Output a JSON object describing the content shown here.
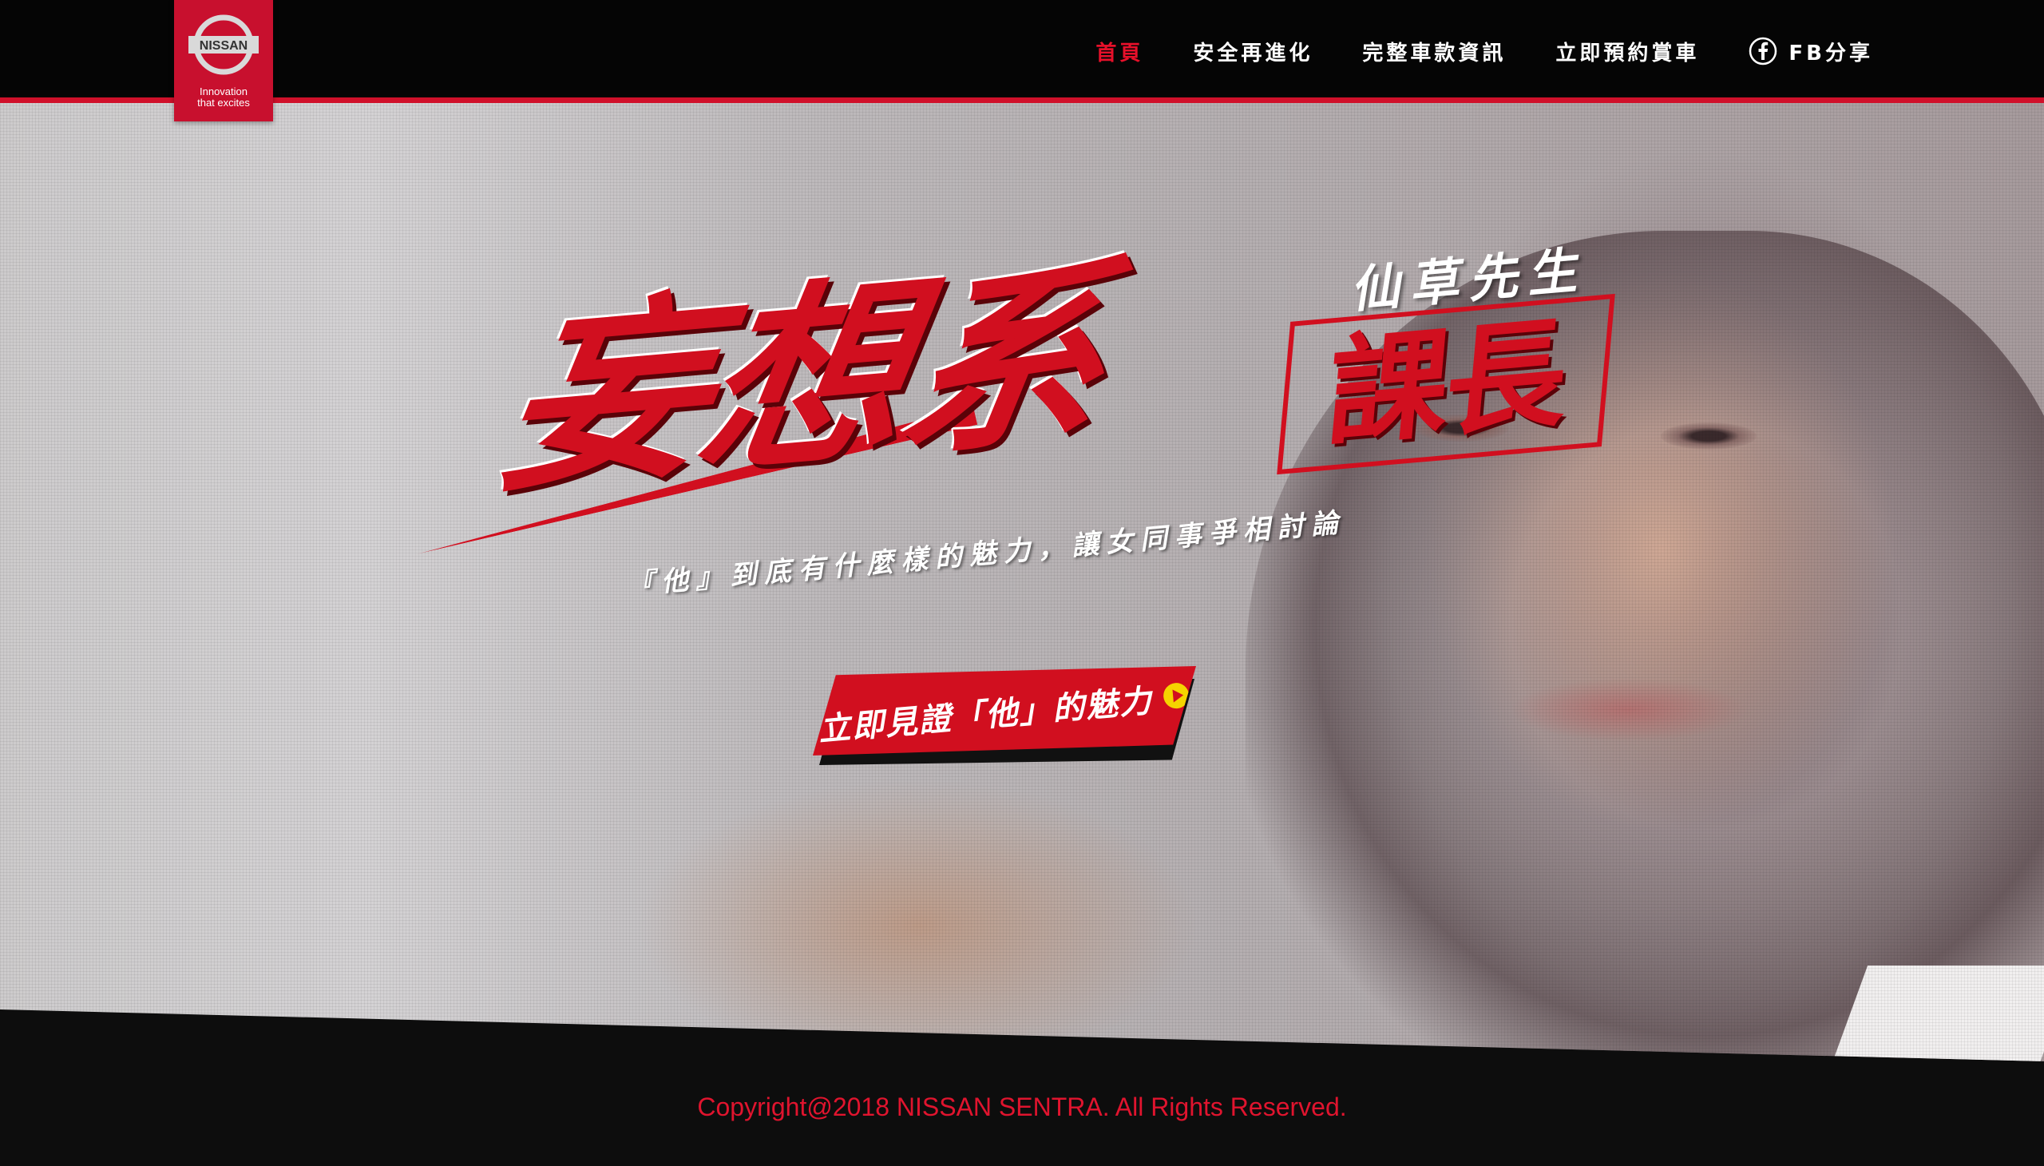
{
  "brand": {
    "logo_text": "NISSAN",
    "tagline_line1": "Innovation",
    "tagline_line2": "that excites",
    "color": "#c8102e"
  },
  "nav": {
    "items": [
      {
        "label": "首頁",
        "active": true
      },
      {
        "label": "安全再進化",
        "active": false
      },
      {
        "label": "完整車款資訊",
        "active": false
      },
      {
        "label": "立即預約賞車",
        "active": false
      }
    ],
    "fb_share": {
      "label": "FB分享",
      "icon": "facebook-icon"
    },
    "active_color": "#e8102a"
  },
  "hero": {
    "title_main": "妄想系",
    "title_box": "課長",
    "title_sub": "仙草先生",
    "tagline": "『他』到底有什麼樣的魅力，讓女同事爭相討論",
    "cta_label": "立即見證「他」的魅力",
    "cta_icon": "play-circle-icon",
    "accent_color": "#d10f1f"
  },
  "footer": {
    "copyright": "Copyright@2018 NISSAN SENTRA. All Rights Reserved."
  }
}
